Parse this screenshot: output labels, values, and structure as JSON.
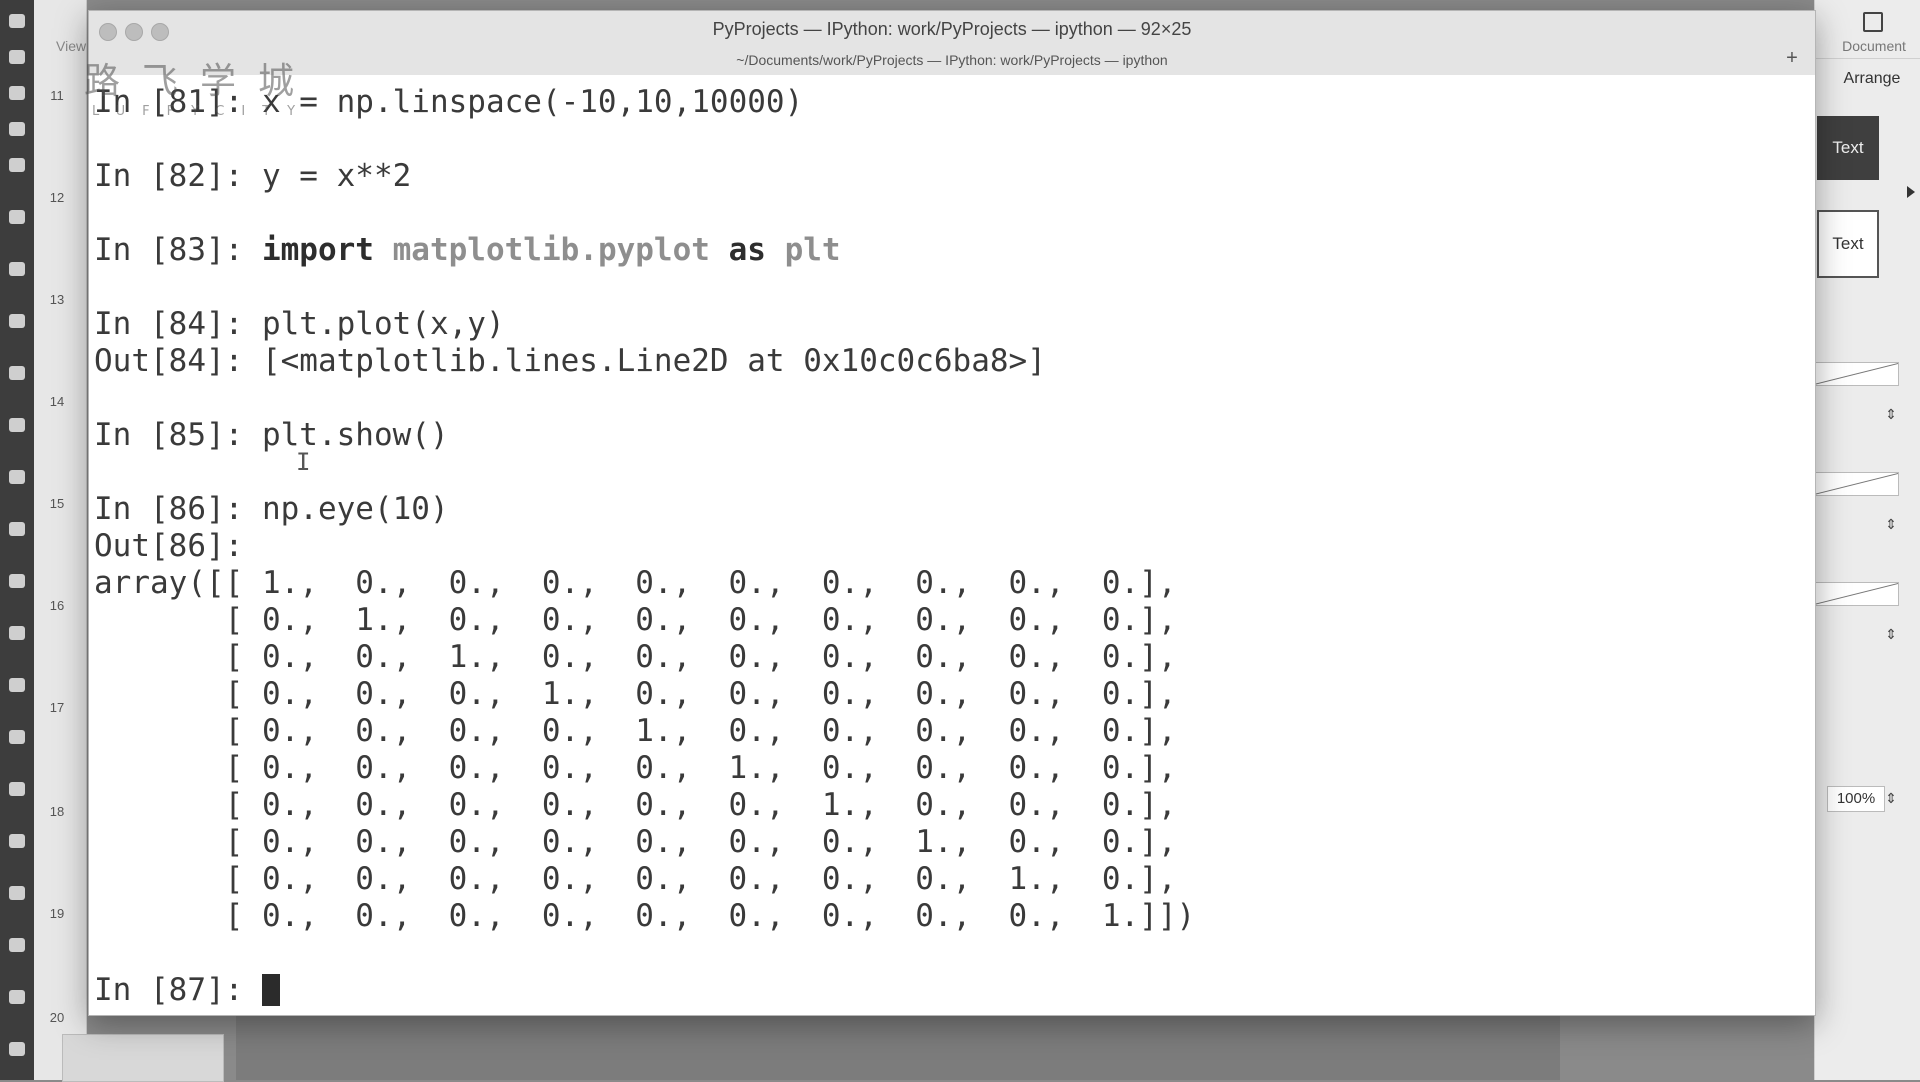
{
  "window": {
    "title": "PyProjects — IPython: work/PyProjects — ipython — 92×25",
    "subtitle": "~/Documents/work/PyProjects — IPython: work/PyProjects — ipython",
    "new_tab_label": "+"
  },
  "ruler": {
    "view_label": "View",
    "page_numbers": [
      "11",
      "12",
      "13",
      "14",
      "15",
      "16",
      "17",
      "18",
      "19",
      "20"
    ]
  },
  "right_panel": {
    "document_label": "Document",
    "arrange_label": "Arrange",
    "style_dark_label": "Text",
    "style_light_label": "Text",
    "zoom": "100%"
  },
  "watermark": {
    "chinese": "路飞学城",
    "english": "LUFFYCITY"
  },
  "terminal": {
    "lines": [
      {
        "prompt": "In [81]: ",
        "code": "x = np.linspace(-10,10,10000)"
      },
      {
        "prompt": "In [82]: ",
        "code": "y = x**2"
      },
      {
        "prompt": "In [83]: ",
        "kw1": "import",
        "module": "matplotlib.pyplot",
        "kw2": "as",
        "alias": "plt"
      },
      {
        "prompt": "In [84]: ",
        "code": "plt.plot(x,y)"
      },
      {
        "prompt": "Out[84]: ",
        "code": "[<matplotlib.lines.Line2D at 0x10c0c6ba8>]"
      },
      {
        "prompt": "In [85]: ",
        "code": "plt.show()"
      },
      {
        "prompt": "In [86]: ",
        "code": "np.eye(10)"
      },
      {
        "prompt": "Out[86]: ",
        "code": ""
      },
      {
        "prompt": "",
        "code": "array([[ 1.,  0.,  0.,  0.,  0.,  0.,  0.,  0.,  0.,  0.],"
      },
      {
        "prompt": "",
        "code": "       [ 0.,  1.,  0.,  0.,  0.,  0.,  0.,  0.,  0.,  0.],"
      },
      {
        "prompt": "",
        "code": "       [ 0.,  0.,  1.,  0.,  0.,  0.,  0.,  0.,  0.,  0.],"
      },
      {
        "prompt": "",
        "code": "       [ 0.,  0.,  0.,  1.,  0.,  0.,  0.,  0.,  0.,  0.],"
      },
      {
        "prompt": "",
        "code": "       [ 0.,  0.,  0.,  0.,  1.,  0.,  0.,  0.,  0.,  0.],"
      },
      {
        "prompt": "",
        "code": "       [ 0.,  0.,  0.,  0.,  0.,  1.,  0.,  0.,  0.,  0.],"
      },
      {
        "prompt": "",
        "code": "       [ 0.,  0.,  0.,  0.,  0.,  0.,  1.,  0.,  0.,  0.],"
      },
      {
        "prompt": "",
        "code": "       [ 0.,  0.,  0.,  0.,  0.,  0.,  0.,  1.,  0.,  0.],"
      },
      {
        "prompt": "",
        "code": "       [ 0.,  0.,  0.,  0.,  0.,  0.,  0.,  0.,  1.,  0.],"
      },
      {
        "prompt": "",
        "code": "       [ 0.,  0.,  0.,  0.,  0.,  0.,  0.,  0.,  0.,  1.]])"
      },
      {
        "prompt": "In [87]: ",
        "code": ""
      }
    ]
  }
}
